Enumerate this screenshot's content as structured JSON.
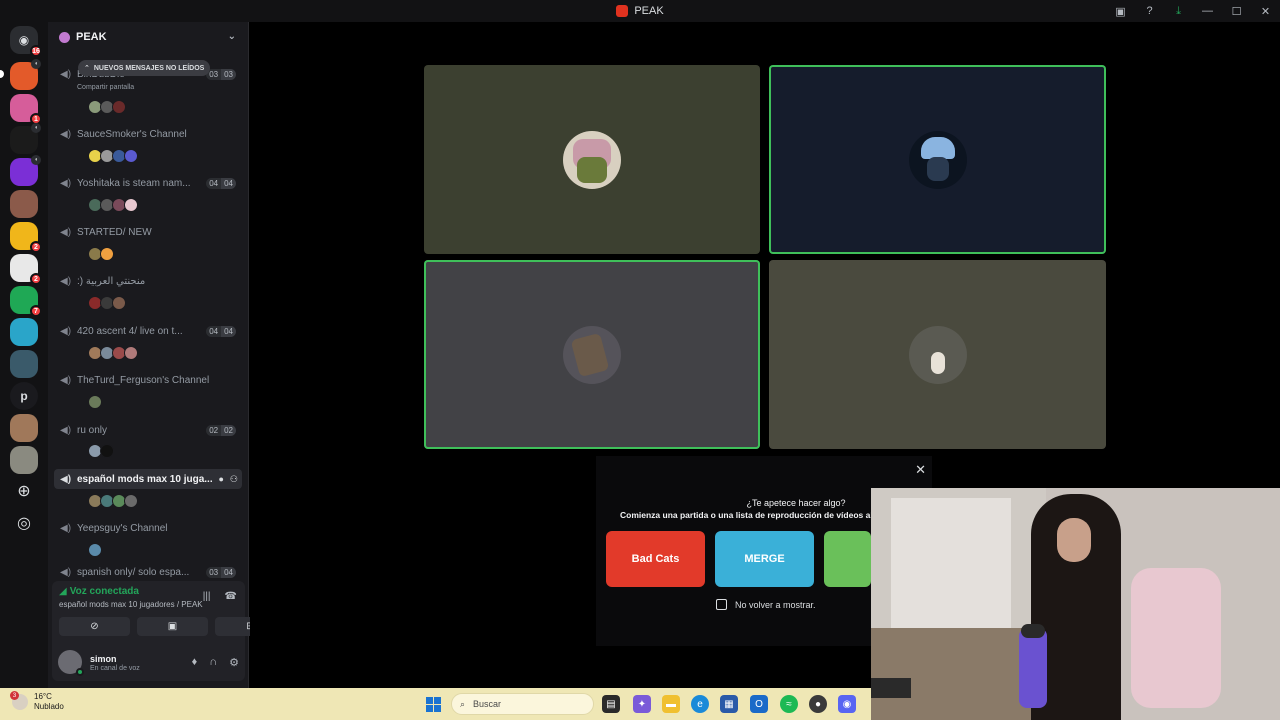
{
  "window": {
    "title": "PEAK"
  },
  "guild": {
    "name": "PEAK"
  },
  "unread_banner": "NUEVOS MENSAJES NO LEÍDOS",
  "channels": [
    {
      "name": "BinDubDie",
      "sub": "Compartir pantalla",
      "count_a": "03",
      "count_b": "03"
    },
    {
      "name": "SauceSmoker's Channel"
    },
    {
      "name": "Yoshitaka is steam nam...",
      "count_a": "04",
      "count_b": "04"
    },
    {
      "name": "STARTED/ NEW"
    },
    {
      "name": ":) منحنتي العربية"
    },
    {
      "name": "420 ascent 4/ live on t...",
      "count_a": "04",
      "count_b": "04"
    },
    {
      "name": "TheTurd_Ferguson's Channel"
    },
    {
      "name": "ru only",
      "count_a": "02",
      "count_b": "02"
    },
    {
      "name": "español mods max 10 juga..."
    },
    {
      "name": "Yeepsguy's Channel"
    },
    {
      "name": "spanish only/ solo espa...",
      "count_a": "03",
      "count_b": "04"
    }
  ],
  "server_badges": {
    "s0": "16",
    "s1": "1",
    "s5": "2",
    "s6": "2",
    "s7": "7"
  },
  "rail_letter": "p",
  "voice": {
    "status": "Voz conectada",
    "channel": "español mods max 10 jugadores / PEAK"
  },
  "user": {
    "name": "simon",
    "status": "En canal de voz"
  },
  "activity": {
    "title": "¿Te apetece hacer algo?",
    "subtitle": "Comienza una partida o una lista de reproducción de vídeos al",
    "cards": [
      "Bad Cats",
      "MERGE",
      ""
    ],
    "checkbox_label": "No volver a mostrar."
  },
  "taskbar": {
    "temp": "16°C",
    "condition": "Nublado",
    "weather_badge": "3",
    "search_placeholder": "Buscar"
  },
  "colors": {
    "accent_green": "#23a55a",
    "speaking_border": "#3fbf5a",
    "mention_red": "#f23f42"
  }
}
